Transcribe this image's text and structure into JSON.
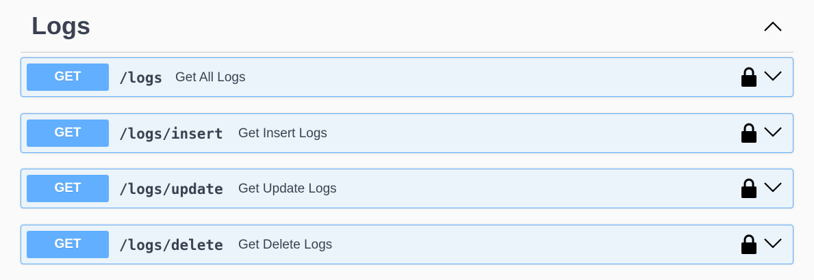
{
  "section": {
    "title": "Logs",
    "toggle_icon": "chevron-up-icon"
  },
  "operations": [
    {
      "method": "GET",
      "path": "/logs",
      "summary": "Get All Logs",
      "lock_icon": "lock-icon",
      "expand_icon": "chevron-down-icon"
    },
    {
      "method": "GET",
      "path": "/logs/insert",
      "summary": "Get Insert Logs",
      "lock_icon": "lock-icon",
      "expand_icon": "chevron-down-icon"
    },
    {
      "method": "GET",
      "path": "/logs/update",
      "summary": "Get Update Logs",
      "lock_icon": "lock-icon",
      "expand_icon": "chevron-down-icon"
    },
    {
      "method": "GET",
      "path": "/logs/delete",
      "summary": "Get Delete Logs",
      "lock_icon": "lock-icon",
      "expand_icon": "chevron-down-icon"
    }
  ],
  "colors": {
    "get_method": "#61affe",
    "get_background": "#ebf3fb",
    "text": "#3b4151"
  }
}
